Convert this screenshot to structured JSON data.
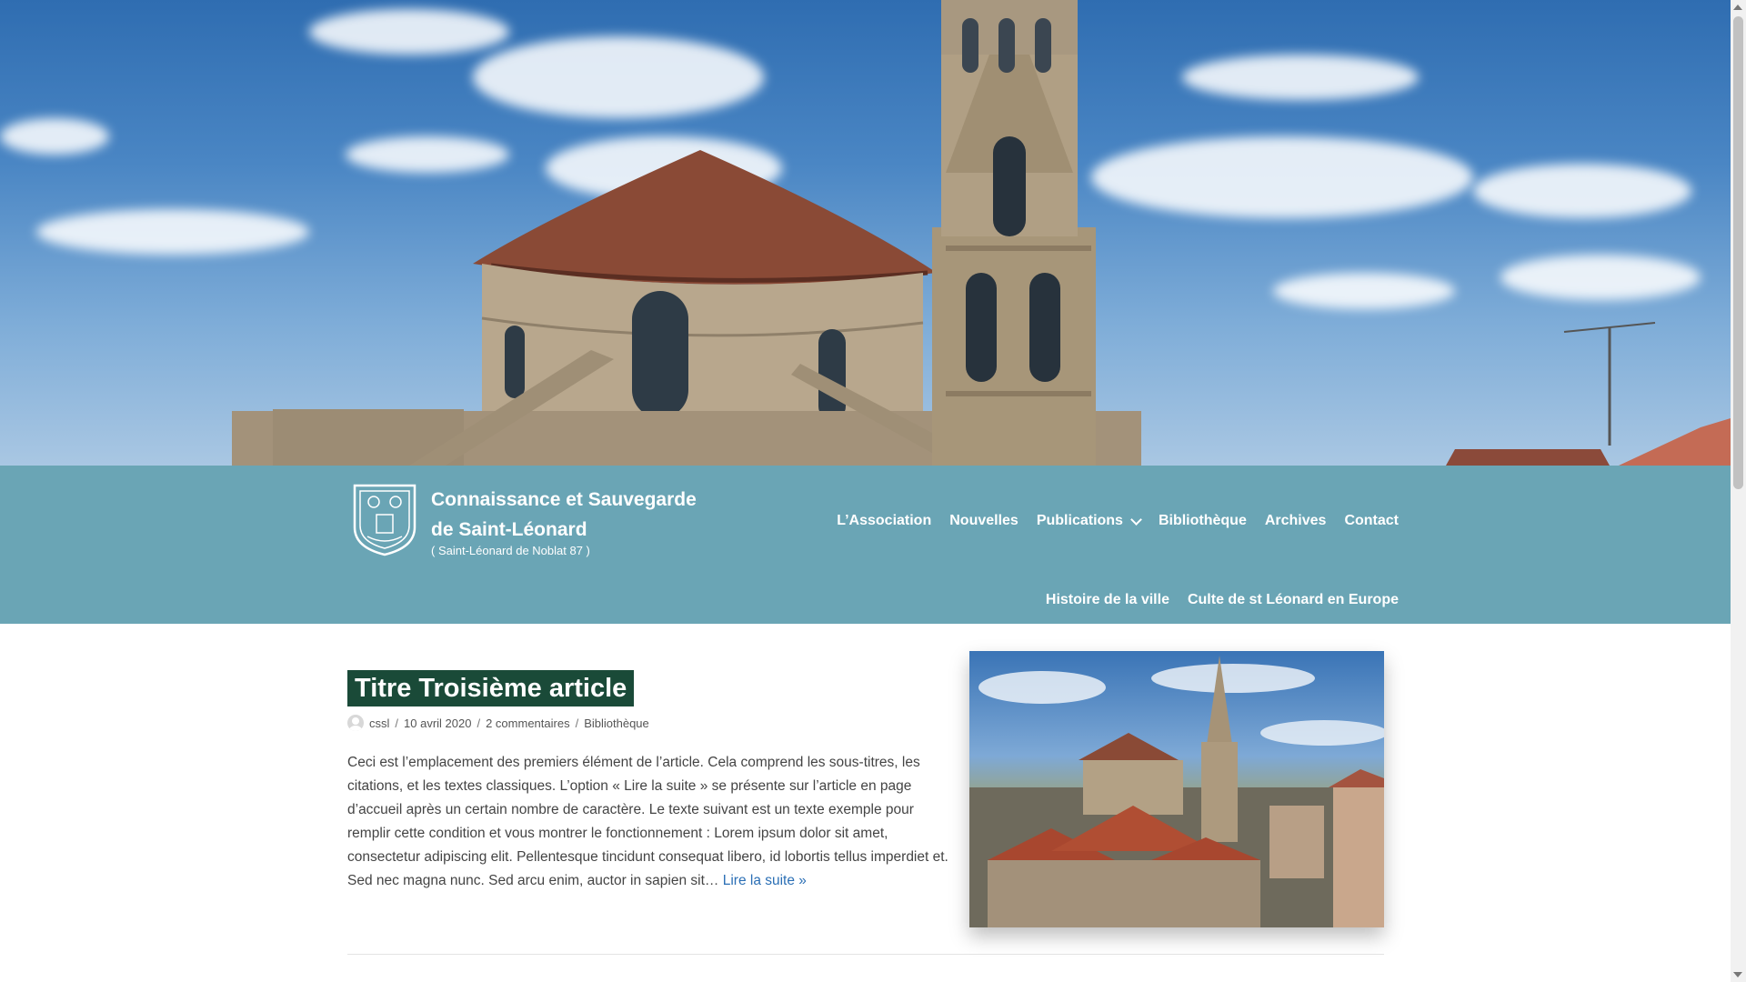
{
  "site": {
    "title_line1": "Connaissance et Sauvegarde",
    "title_line2": "de Saint-Léonard",
    "tagline": "( Saint-Léonard de Noblat 87 )"
  },
  "nav": {
    "primary": [
      "L’Association",
      "Nouvelles",
      "Publications",
      "Bibliothèque",
      "Archives",
      "Contact"
    ],
    "secondary": [
      "Histoire de la ville",
      "Culte de st Léonard en Europe"
    ]
  },
  "article": {
    "title": "Titre Troisième article",
    "author": "cssl",
    "date": "10 avril 2020",
    "comments": "2 commentaires",
    "category": "Bibliothèque",
    "excerpt": "Ceci est l’emplacement des premiers élément de l’article. Cela comprend les sous-titres, les citations, et les textes classiques. L’option « Lire la suite » se présente sur l’article en page d’accueil après un certain nombre de caractère. Le texte suivant est un texte exemple pour remplir cette condition et vous montrer le fonctionnement : Lorem ipsum dolor sit amet, consectetur adipiscing elit. Pellentesque tincidunt consequat libero, id lobortis tellus imperdiet et. Sed nec magna nunc. Sed arcu enim, auctor in sapien sit…",
    "read_more": "Lire la suite »"
  },
  "icons": {
    "logo": "shield-logo-icon",
    "avatar": "user-avatar-icon",
    "dropdown": "chevron-down-icon"
  },
  "colors": {
    "header_bg": "#6aa5b5",
    "title_bg": "#1a4a38",
    "link": "#2b6fb5"
  }
}
